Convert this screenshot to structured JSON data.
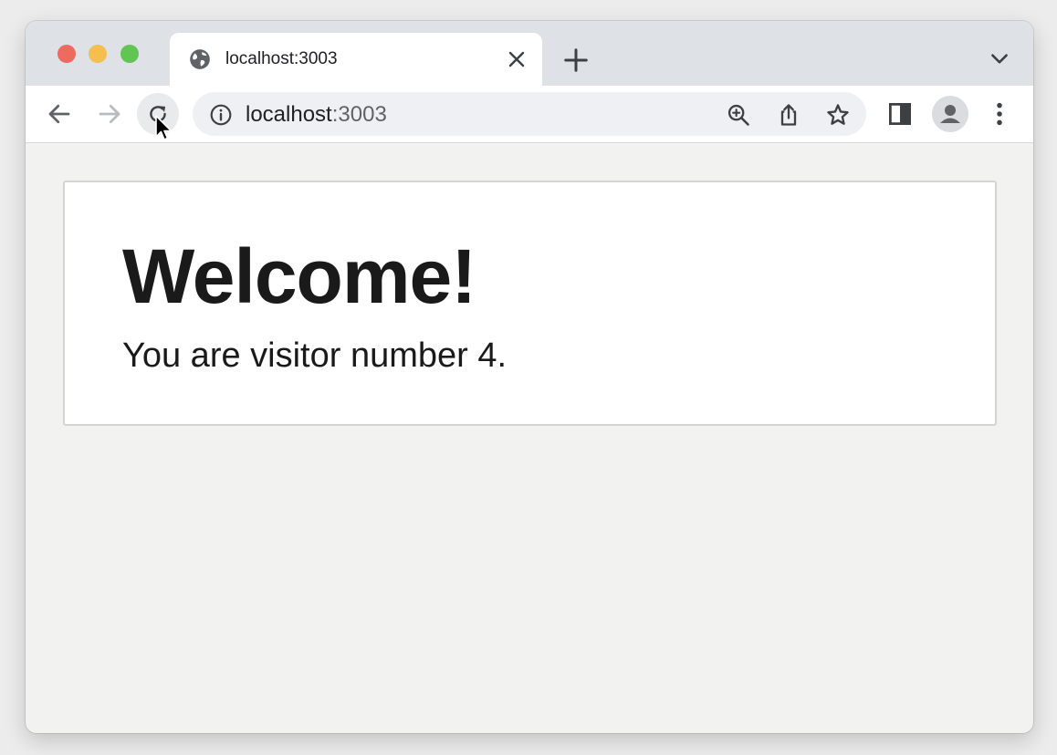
{
  "window": {
    "traffic_lights": {
      "close": "#ec6a5e",
      "minimize": "#f4bf4f",
      "zoom": "#61c554"
    }
  },
  "tab": {
    "title": "localhost:3003",
    "favicon": "globe-icon"
  },
  "toolbar": {
    "back": "arrow-left-icon",
    "forward": "arrow-right-icon",
    "reload": "reload-icon",
    "url_host": "localhost",
    "url_port": ":3003",
    "icons": [
      "zoom-icon",
      "share-icon",
      "star-icon",
      "side-panel-icon",
      "profile-icon",
      "more-vert-icon"
    ]
  },
  "page": {
    "heading": "Welcome!",
    "message": "You are visitor number 4."
  },
  "colors": {
    "tabstrip": "#dee1e6",
    "page_background": "#f2f2f1",
    "card_border": "#d4d4d4",
    "text": "#1a1a1a"
  }
}
